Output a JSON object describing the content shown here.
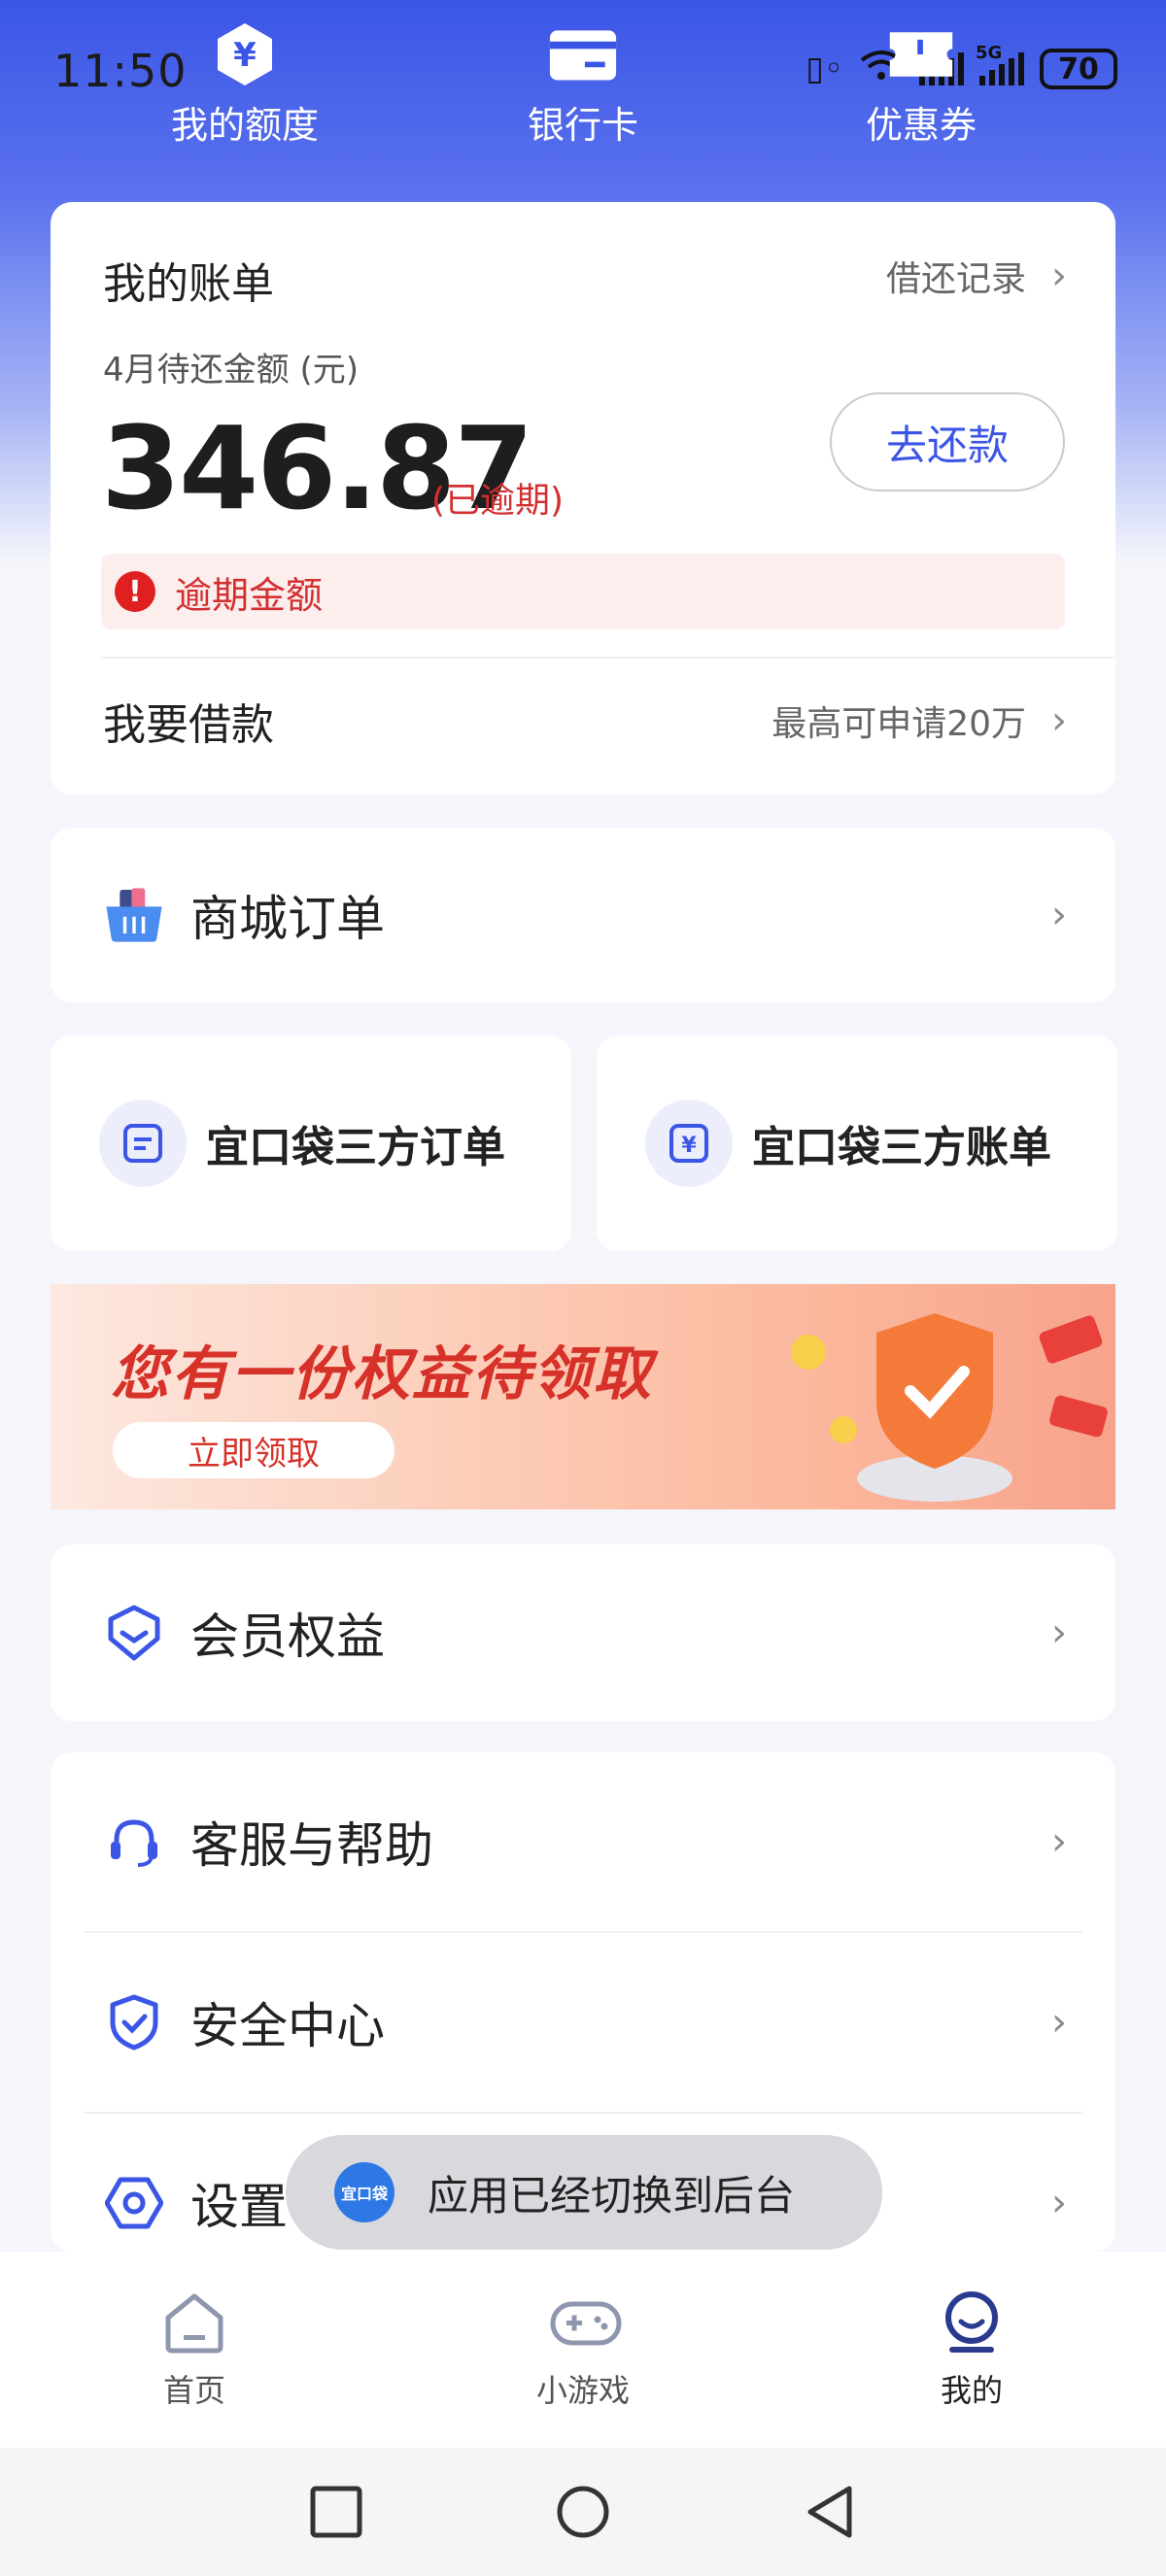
{
  "status_bar": {
    "time": "11:50",
    "battery": "70",
    "network_1": "5G",
    "network_2": "5G"
  },
  "quick_nav": [
    {
      "label": "我的额度",
      "icon": "yuan-hexagon-icon"
    },
    {
      "label": "银行卡",
      "icon": "bank-card-icon"
    },
    {
      "label": "优惠券",
      "icon": "coupon-icon"
    }
  ],
  "bill": {
    "title": "我的账单",
    "record_link": "借还记录",
    "subtitle": "4月待还金额 (元)",
    "amount": "346.87",
    "status": "(已逾期)",
    "repay_button": "去还款",
    "overdue_label": "逾期金额",
    "loan_title": "我要借款",
    "loan_hint": "最高可申请20万"
  },
  "mall_order": {
    "label": "商城订单",
    "icon": "shopping-basket-icon"
  },
  "third_party": [
    {
      "label": "宜口袋三方订单",
      "icon": "order-doc-icon"
    },
    {
      "label": "宜口袋三方账单",
      "icon": "yuan-bill-icon"
    }
  ],
  "banner": {
    "title": "您有一份权益待领取",
    "button": "立即领取"
  },
  "member": {
    "label": "会员权益",
    "icon": "member-badge-icon"
  },
  "menu": [
    {
      "label": "客服与帮助",
      "icon": "headset-icon"
    },
    {
      "label": "安全中心",
      "icon": "shield-icon"
    },
    {
      "label": "设置",
      "icon": "settings-hexagon-icon"
    }
  ],
  "toast": {
    "text": "应用已经切换到后台",
    "logo_text": "宜口袋"
  },
  "tab_bar": [
    {
      "label": "首页",
      "icon": "home-icon"
    },
    {
      "label": "小游戏",
      "icon": "gamepad-icon"
    },
    {
      "label": "我的",
      "icon": "profile-icon"
    }
  ],
  "colors": {
    "brand": "#3b56e6",
    "danger": "#d32f2f"
  }
}
